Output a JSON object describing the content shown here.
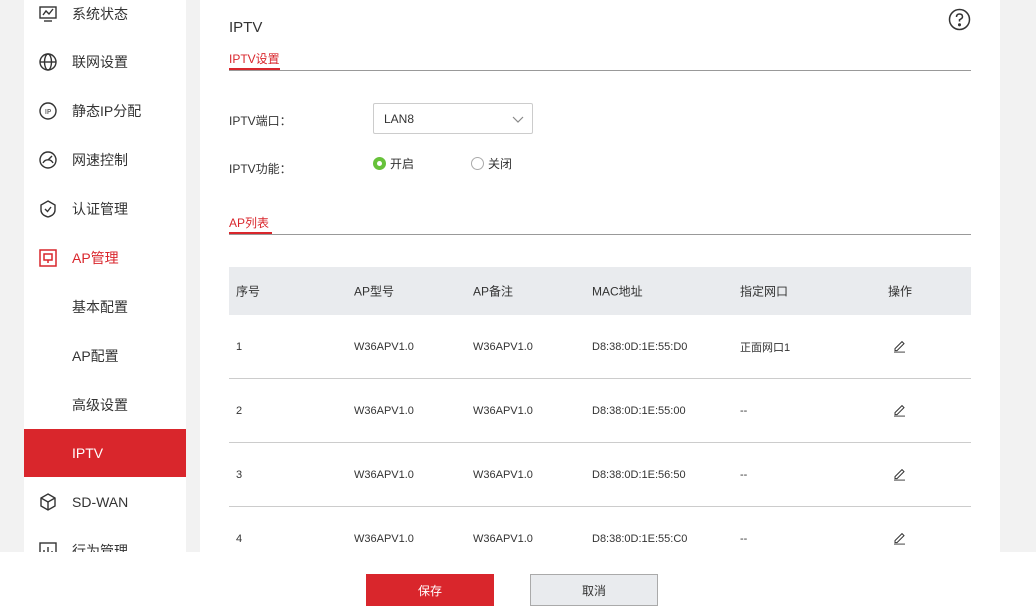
{
  "sidebar": {
    "items": [
      {
        "label": "系统状态",
        "icon": "monitor-chart-icon"
      },
      {
        "label": "联网设置",
        "icon": "globe-icon"
      },
      {
        "label": "静态IP分配",
        "icon": "ip-icon"
      },
      {
        "label": "网速控制",
        "icon": "speedometer-icon"
      },
      {
        "label": "认证管理",
        "icon": "shield-check-icon"
      },
      {
        "label": "AP管理",
        "icon": "ap-device-icon"
      },
      {
        "label": "基本配置"
      },
      {
        "label": "AP配置"
      },
      {
        "label": "高级设置"
      },
      {
        "label": "IPTV"
      },
      {
        "label": "SD-WAN",
        "icon": "cube-icon"
      },
      {
        "label": "行为管理",
        "icon": "bar-chart-icon"
      }
    ],
    "active_color": "#d9262c"
  },
  "main": {
    "title": "IPTV",
    "section1_tab": "IPTV设置",
    "port_label": "IPTV端口：",
    "port_value": "LAN8",
    "function_label": "IPTV功能：",
    "radio_on": "开启",
    "radio_off": "关闭",
    "section2_tab": "AP列表",
    "table": {
      "headers": [
        "序号",
        "AP型号",
        "AP备注",
        "MAC地址",
        "指定网口",
        "操作"
      ],
      "rows": [
        [
          "1",
          "W36APV1.0",
          "W36APV1.0",
          "D8:38:0D:1E:55:D0",
          "正面网口1"
        ],
        [
          "2",
          "W36APV1.0",
          "W36APV1.0",
          "D8:38:0D:1E:55:00",
          "--"
        ],
        [
          "3",
          "W36APV1.0",
          "W36APV1.0",
          "D8:38:0D:1E:56:50",
          "--"
        ],
        [
          "4",
          "W36APV1.0",
          "W36APV1.0",
          "D8:38:0D:1E:55:C0",
          "--"
        ]
      ]
    }
  },
  "footer": {
    "save_label": "保存",
    "cancel_label": "取消"
  }
}
